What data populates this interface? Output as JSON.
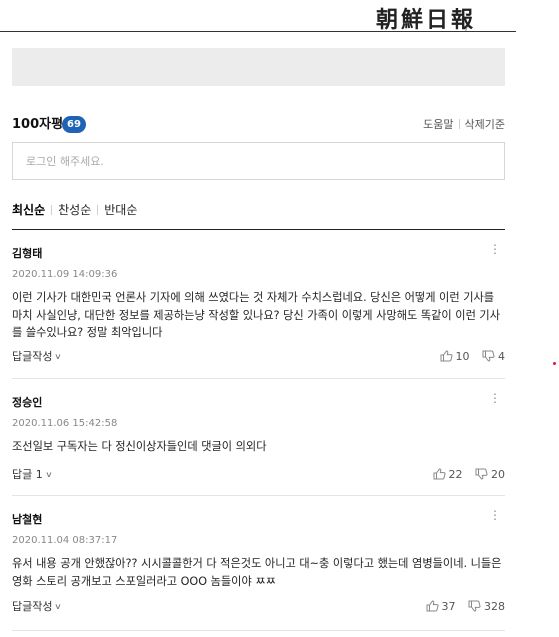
{
  "header": {
    "logo_text": "朝鮮日報"
  },
  "comments_section": {
    "title": "100자평",
    "count": "69",
    "help_label": "도움말",
    "delete_policy_label": "삭제기준",
    "login_placeholder": "로그인 해주세요.",
    "sort_tabs": [
      {
        "label": "최신순",
        "active": true
      },
      {
        "label": "찬성순",
        "active": false
      },
      {
        "label": "반대순",
        "active": false
      }
    ],
    "comments": [
      {
        "author": "김형태",
        "date": "2020.11.09 14:09:36",
        "text": "이런 기사가 대한민국 언론사 기자에 의해 쓰였다는 것 자체가 수치스럽네요. 당신은 어떻게 이런 기사를 마치 사실인냥, 대단한 정보를 제공하는냥 작성할 있나요? 당신 가족이 이렇게 사망해도 똑같이 이런 기사를 쓸수있나요? 정말 최악입니다",
        "reply_label": "답글작성",
        "likes": "10",
        "dislikes": "4"
      },
      {
        "author": "정승인",
        "date": "2020.11.06 15:42:58",
        "text": "조선일보 구독자는 다 정신이상자들인데 댓글이 의외다",
        "reply_label": "답글 1",
        "likes": "22",
        "dislikes": "20"
      },
      {
        "author": "남철현",
        "date": "2020.11.04 08:37:17",
        "text": "유서 내용 공개 안했잖아?? 시시콜콜한거 다 적은것도 아니고 대~충 이렇다고 했는데 염병들이네. 니들은 영화 스토리 공개보고 스포일러라고 OOO 놈들이야 ㅉㅉ",
        "reply_label": "답글작성",
        "likes": "37",
        "dislikes": "328"
      }
    ]
  },
  "colors": {
    "count_badge": "#1f63b6",
    "ad_placeholder": "#ececec",
    "marker_dot": "#e0183c"
  },
  "icons": {
    "like": "thumbs-up-icon",
    "dislike": "thumbs-down-icon",
    "more": "more-vertical-icon",
    "expand": "chevron-down-icon"
  }
}
